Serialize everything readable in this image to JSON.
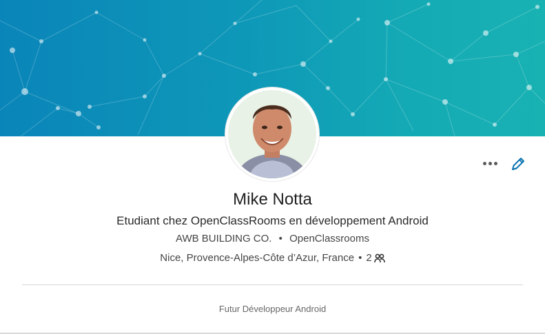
{
  "colors": {
    "banner_start": "#0a85b9",
    "banner_end": "#19b2b3",
    "edit_icon": "#0a73b1"
  },
  "profile": {
    "name": "Mike Notta",
    "headline": "Etudiant chez OpenClassRooms en développement Android",
    "company": "AWB BUILDING CO.",
    "separator": "•",
    "school": "OpenClassrooms",
    "location": "Nice, Provence-Alpes-Côte d’Azur, France",
    "connections": "2",
    "connections_icon": "people-icon",
    "summary": "Futur Développeur Android"
  },
  "actions": {
    "more_icon": "more-horizontal-icon",
    "edit_icon": "pencil-icon"
  }
}
